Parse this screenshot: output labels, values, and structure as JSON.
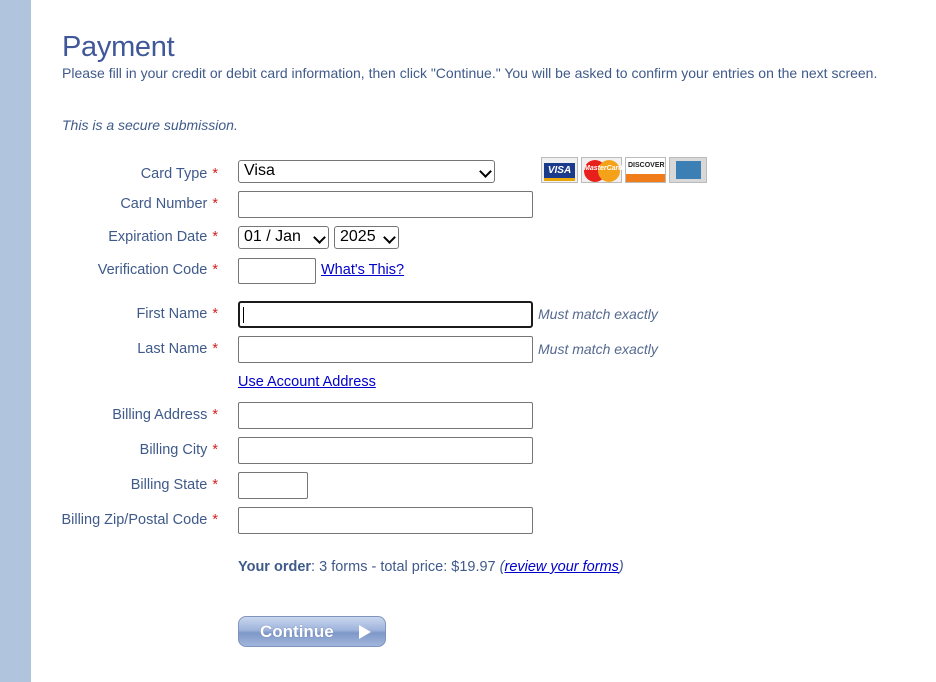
{
  "page": {
    "title": "Payment",
    "intro": "Please fill in your credit or debit card information, then click \"Continue.\" You will be asked to confirm your entries on the next screen.",
    "secure_note": "This is a secure submission."
  },
  "form": {
    "required_marker": "*",
    "card_type": {
      "label": "Card Type",
      "value": "Visa"
    },
    "card_number": {
      "label": "Card Number",
      "value": ""
    },
    "expiration": {
      "label": "Expiration Date",
      "month_value": "01 / Jan",
      "year_value": "2025"
    },
    "verification": {
      "label": "Verification Code",
      "value": "",
      "help_link": "What's This?"
    },
    "first_name": {
      "label": "First Name",
      "value": "",
      "hint": "Must match exactly"
    },
    "last_name": {
      "label": "Last Name",
      "value": "",
      "hint": "Must match exactly"
    },
    "use_account_address": "Use Account Address",
    "billing_address": {
      "label": "Billing Address",
      "value": ""
    },
    "billing_city": {
      "label": "Billing City",
      "value": ""
    },
    "billing_state": {
      "label": "Billing State",
      "value": ""
    },
    "billing_zip": {
      "label": "Billing Zip/Postal Code",
      "value": ""
    }
  },
  "card_logos": {
    "visa": "VISA",
    "mastercard": "MasterCard",
    "discover": "DISCOVER"
  },
  "order": {
    "label": "Your order",
    "summary": ": 3 forms - total price: $19.97 ",
    "open_paren": "(",
    "review_link": "review your forms",
    "close_paren": ")"
  },
  "continue_button": {
    "label": "Continue"
  },
  "colors": {
    "sidebar": "#b0c4de",
    "heading": "#40589a",
    "text": "#3f5a8a",
    "required": "#d12222",
    "link": "#0000cc"
  }
}
